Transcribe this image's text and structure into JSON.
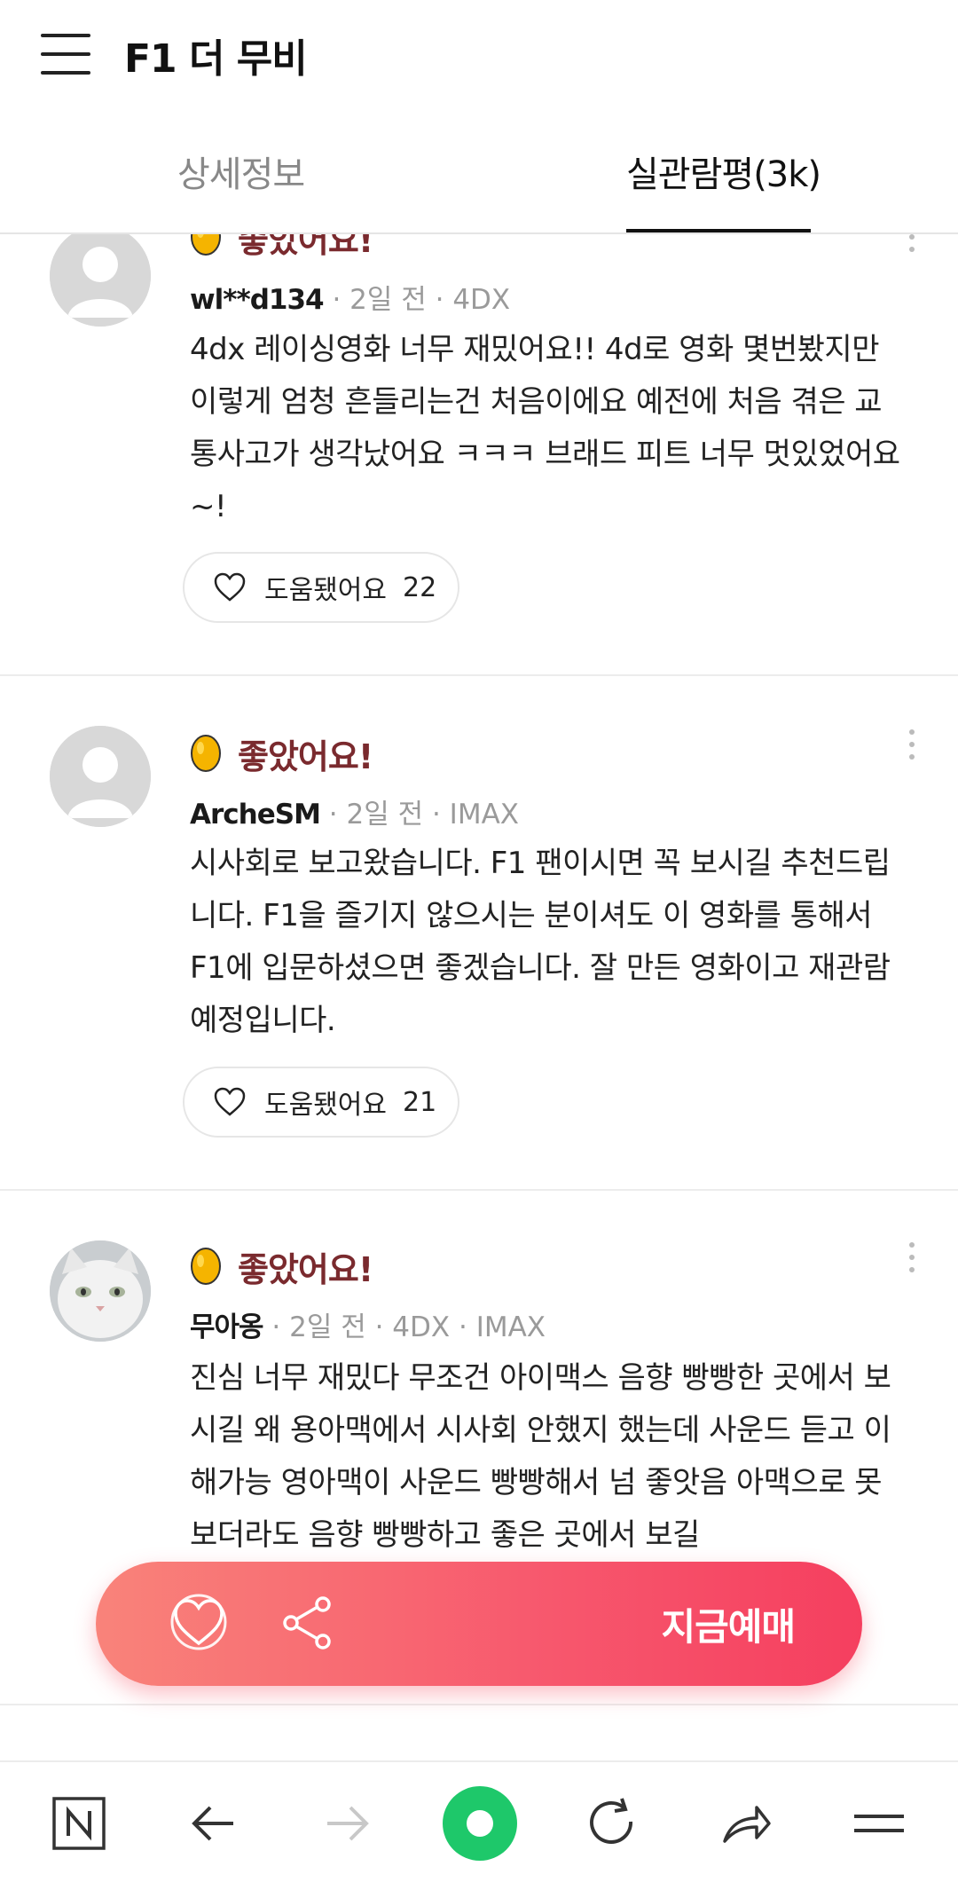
{
  "header": {
    "title": "F1 더 무비",
    "menu_icon": "hamburger-menu-icon"
  },
  "tabs": [
    {
      "label": "상세정보",
      "active": false
    },
    {
      "label": "실관람평(3k)",
      "active": true
    }
  ],
  "reviews": [
    {
      "rating_label": "좋았어요!",
      "username": "wl**d134",
      "meta": " · 2일 전 · 4DX",
      "text": "4dx 레이싱영화 너무 재밌어요!! 4d로 영화 몇번봤지만 이렇게 엄청 흔들리는건 처음이에요 예전에 처음 겪은 교통사고가 생각났어요 ㅋㅋㅋ 브래드 피트 너무 멋있었어요~!",
      "helpful_label": "도움됐어요",
      "helpful_count": "22"
    },
    {
      "rating_label": "좋았어요!",
      "username": "ArcheSM",
      "meta": " · 2일 전 · IMAX",
      "text": "시사회로 보고왔습니다. F1 팬이시면 꼭 보시길 추천드립니다. F1을 즐기지 않으시는 분이셔도 이 영화를 통해서 F1에 입문하셨으면 좋겠습니다. 잘 만든 영화이고 재관람 예정입니다.",
      "helpful_label": "도움됐어요",
      "helpful_count": "21"
    },
    {
      "rating_label": "좋았어요!",
      "username": "무아옹",
      "meta": " · 2일 전 · 4DX · IMAX",
      "text": "진심 너무 재밌다 무조건 아이맥스 음향 빵빵한 곳에서 보시길 왜 용아맥에서 시사회 안했지 했는데 사운드 듣고 이해가능 영아맥이 사운드 빵빵해서 넘 좋앗음 아맥으로 못보더라도 음향 빵빵하고 좋은 곳에서 보길"
    }
  ],
  "cta": {
    "book_label": "지금예매",
    "like_icon": "heart-icon",
    "share_icon": "share-icon"
  },
  "bottom_nav": {
    "items": [
      "naver-home-icon",
      "back-arrow-icon",
      "forward-arrow-icon",
      "green-dot-icon",
      "refresh-icon",
      "share-icon",
      "menu-icon"
    ]
  },
  "colors": {
    "accent": "#f7576d",
    "rating_text": "#7a2a2e",
    "egg": "#f5b400",
    "green": "#1ec800"
  }
}
